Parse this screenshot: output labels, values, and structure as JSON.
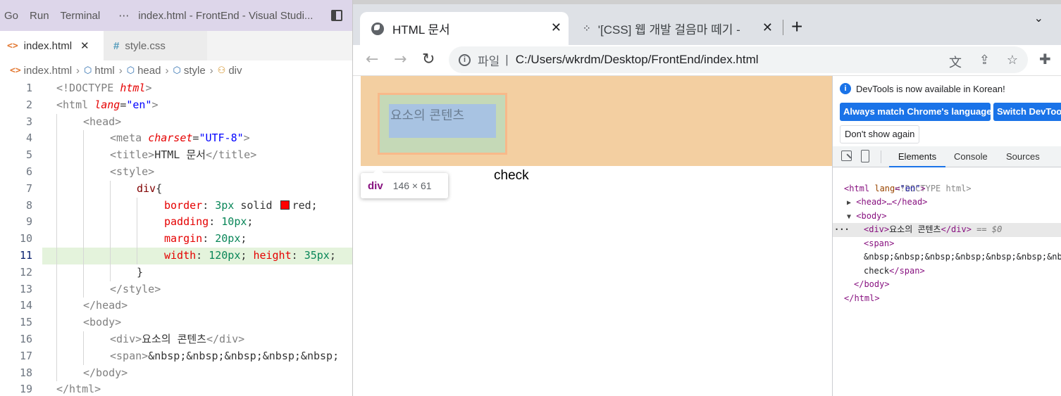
{
  "vscode": {
    "menu": [
      "Go",
      "Run",
      "Terminal"
    ],
    "more": "⋯",
    "window_title": "index.html - FrontEnd - Visual Studi...",
    "tabs": [
      {
        "label": "index.html",
        "close": "✕"
      },
      {
        "label": "style.css"
      }
    ],
    "breadcrumb": [
      "index.html",
      "html",
      "head",
      "style",
      "div"
    ],
    "code_lines": {
      "l1": {
        "num": "1",
        "a": "<!DOCTYPE ",
        "b": "html",
        "c": ">"
      },
      "l2": {
        "num": "2",
        "a": "<html ",
        "b": "lang",
        "c": "=",
        "d": "\"en\"",
        "e": ">"
      },
      "l3": {
        "num": "3",
        "a": "<head>"
      },
      "l4": {
        "num": "4",
        "a": "<meta ",
        "b": "charset",
        "c": "=",
        "d": "\"UTF-8\"",
        "e": ">"
      },
      "l5": {
        "num": "5",
        "a": "<title>",
        "b": "HTML 문서",
        "c": "</title>"
      },
      "l6": {
        "num": "6",
        "a": "<style>"
      },
      "l7": {
        "num": "7",
        "a": "div",
        "b": "{"
      },
      "l8": {
        "num": "8",
        "a": "border",
        "b": ": ",
        "c": "3px",
        "d": " solid ",
        "e": "red",
        "f": ";"
      },
      "l9": {
        "num": "9",
        "a": "padding",
        "b": ": ",
        "c": "10px",
        "d": ";"
      },
      "l10": {
        "num": "10",
        "a": "margin",
        "b": ": ",
        "c": "20px",
        "d": ";"
      },
      "l11": {
        "num": "11",
        "a": "width",
        "b": ": ",
        "c": "120px",
        "d": "; ",
        "e": "height",
        "f": ": ",
        "g": "35px",
        "h": ";"
      },
      "l12": {
        "num": "12",
        "a": "}"
      },
      "l13": {
        "num": "13",
        "a": "</style>"
      },
      "l14": {
        "num": "14",
        "a": "</head>"
      },
      "l15": {
        "num": "15",
        "a": "<body>"
      },
      "l16": {
        "num": "16",
        "a": "<div>",
        "b": "요소의 콘텐츠",
        "c": "</div>"
      },
      "l17": {
        "num": "17",
        "a": "<span>",
        "b": "&nbsp;&nbsp;&nbsp;&nbsp;&nbsp;"
      },
      "l18": {
        "num": "18",
        "a": "</body>"
      },
      "l19": {
        "num": "19",
        "a": "</html>"
      }
    }
  },
  "chrome": {
    "tabs": [
      {
        "title": "HTML 문서",
        "close": "✕"
      },
      {
        "title": "'[CSS] 웹 개발 걸음마 떼기 -",
        "close": "✕"
      }
    ],
    "new_tab": "+",
    "tab_search": "⌄",
    "back": "←",
    "forward": "→",
    "reload": "↻",
    "omnibox": {
      "scheme_label": "파일",
      "separator": "|",
      "url": "C:/Users/wkrdm/Desktop/FrontEnd/index.html"
    },
    "page": {
      "div_text": "요소의 콘텐츠",
      "span_text": "check",
      "tooltip": {
        "tag": "div",
        "size": "146 × 61"
      }
    },
    "devtools": {
      "notice": "DevTools is now available in Korean!",
      "match_button": "Always match Chrome's language",
      "switch_button": "Switch DevTools to Korean",
      "dont_show": "Don't show again",
      "tabs": [
        "Elements",
        "Console",
        "Sources"
      ],
      "dom": {
        "doctype": "<!DOCTYPE html>",
        "html_open": "<html",
        "lang_attr": "lang",
        "lang_val": "\"en\"",
        "gt": ">",
        "head": "<head>…</head>",
        "body_open": "<body>",
        "div_open": "<div>",
        "div_text": "요소의 콘텐츠",
        "div_close": "</div>",
        "eq": " == $0",
        "span_open": "<span>",
        "nbsp": "&nbsp;&nbsp;&nbsp;&nbsp;&nbsp;&nbsp;&nbsp;&nbsp;&",
        "check": "check",
        "span_close": "</span>",
        "body_close": "</body>",
        "html_close": "</html>",
        "dots": "···",
        "arrow_right": "▶",
        "arrow_down": "▼"
      }
    }
  },
  "colors": {
    "accent_blue": "#1a73e8",
    "highlight_line": "#e4f3dc",
    "margin_overlay": "#f3cfa1",
    "padding_overlay": "#c5d9b7",
    "content_overlay": "#a8c3e2"
  }
}
